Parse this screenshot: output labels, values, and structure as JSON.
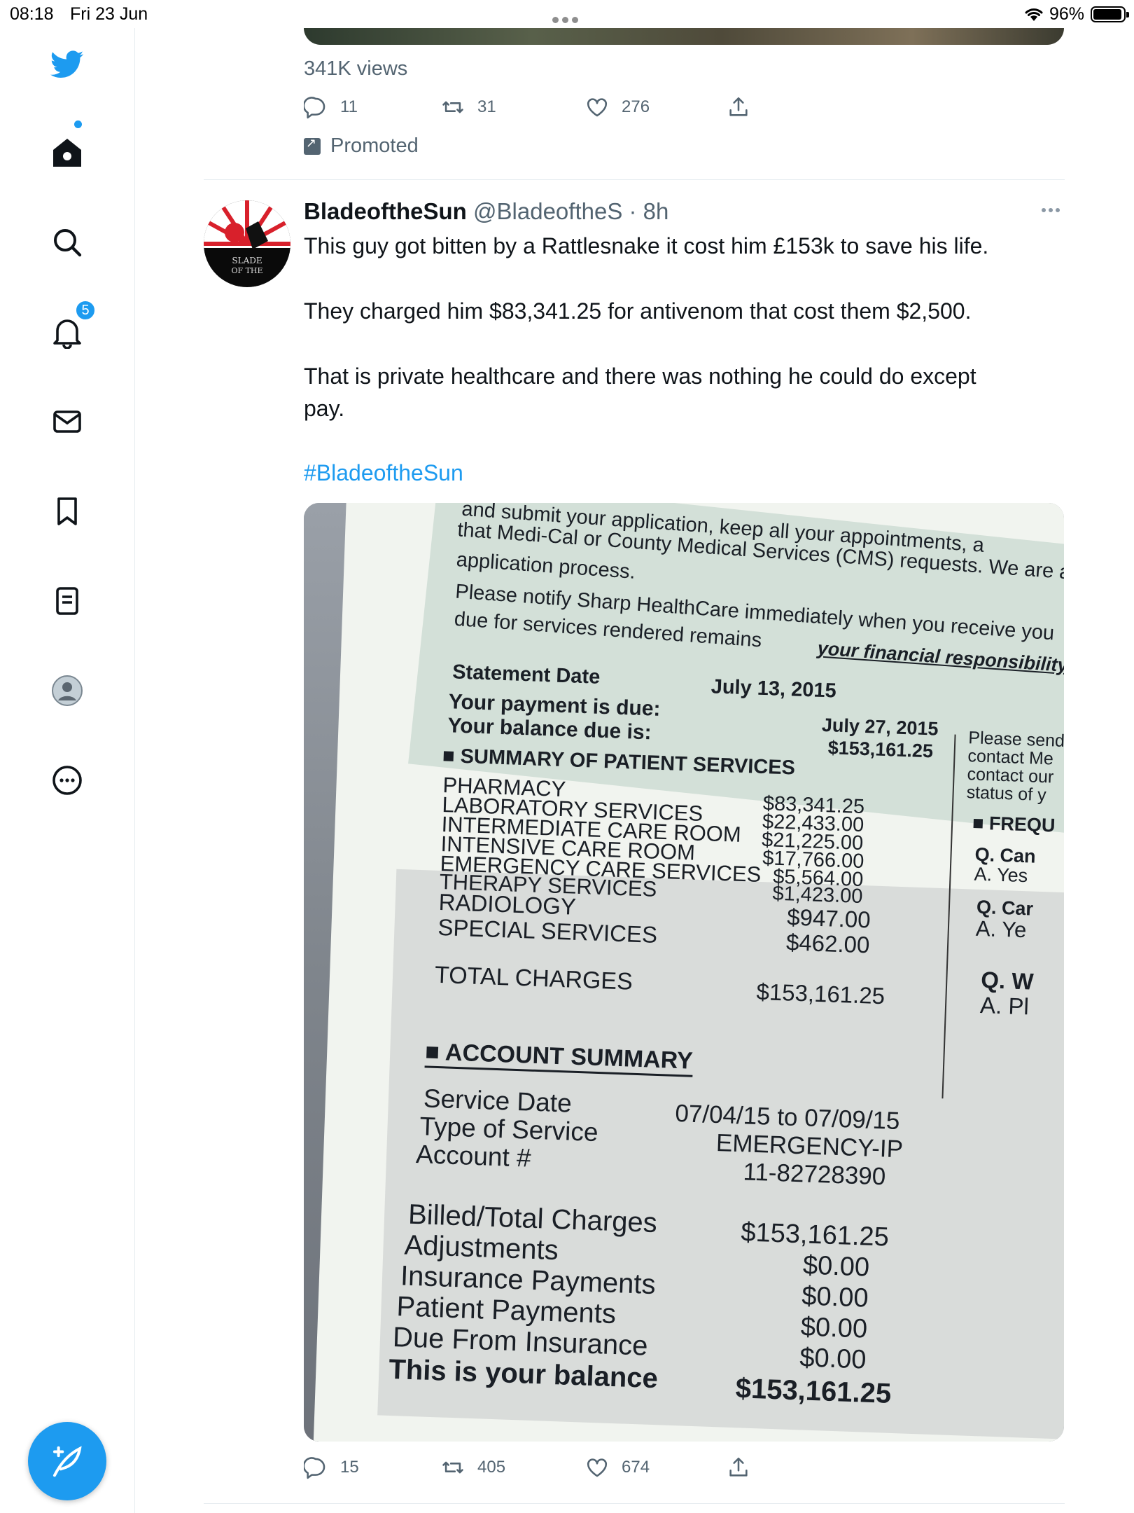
{
  "status_bar": {
    "time": "08:18",
    "date": "Fri 23 Jun",
    "battery": "96%"
  },
  "sidebar": {
    "notifications_badge": "5",
    "items": [
      "twitter-logo",
      "home",
      "search",
      "notifications",
      "messages",
      "bookmarks",
      "lists",
      "profile",
      "more"
    ]
  },
  "prev_tweet": {
    "views": "341K views",
    "replies": "11",
    "retweets": "31",
    "likes": "276",
    "promoted": "Promoted"
  },
  "tweet": {
    "name": "BladeoftheSun",
    "handle": "@BladeoftheS",
    "time": "· 8h",
    "line1": "This guy got bitten by a Rattlesnake it cost him £153k to save his life.",
    "line2": "They charged him $83,341.25 for antivenom that cost them $2,500.",
    "line3a": "That is private healthcare and there was nothing he could do except",
    "line3b": "pay.",
    "hashtag": "#BladeoftheSun",
    "replies": "15",
    "retweets": "405",
    "likes": "674"
  },
  "bill": {
    "top_lines": [
      "and submit your application, keep all your appointments, a",
      "that Medi-Cal or County Medical Services (CMS) requests. We are a",
      "application process."
    ],
    "notify_1": "Please notify Sharp HealthCare immediately when you receive you",
    "notify_2": "due for services rendered remains",
    "notify_3": "your financial responsibility.",
    "statement_date_label": "Statement Date",
    "statement_date": "July 13, 2015",
    "payment_due_label": "Your payment is due:",
    "payment_due": "July 27, 2015",
    "balance_due_label": "Your balance due is:",
    "balance_due": "$153,161.25",
    "summary_title": "SUMMARY OF PATIENT SERVICES",
    "services": [
      {
        "name": "PHARMACY",
        "amount": "$83,341.25"
      },
      {
        "name": "LABORATORY SERVICES",
        "amount": "$22,433.00"
      },
      {
        "name": "INTERMEDIATE CARE ROOM",
        "amount": "$21,225.00"
      },
      {
        "name": "INTENSIVE CARE ROOM",
        "amount": "$17,766.00"
      },
      {
        "name": "EMERGENCY CARE SERVICES",
        "amount": "$5,564.00"
      },
      {
        "name": "THERAPY SERVICES",
        "amount": "$1,423.00"
      },
      {
        "name": "RADIOLOGY",
        "amount": "$947.00"
      },
      {
        "name": "SPECIAL SERVICES",
        "amount": "$462.00"
      }
    ],
    "total_label": "TOTAL CHARGES",
    "total": "$153,161.25",
    "account_title": "ACCOUNT SUMMARY",
    "service_date_label": "Service Date",
    "service_date": "07/04/15 to 07/09/15",
    "service_type_label": "Type of Service",
    "service_type": "EMERGENCY-IP",
    "account_label": "Account #",
    "account": "11-82728390",
    "billed_label": "Billed/Total Charges",
    "billed": "$153,161.25",
    "adjustments_label": "Adjustments",
    "adjustments": "$0.00",
    "insurance_label": "Insurance Payments",
    "insurance": "$0.00",
    "patient_label": "Patient Payments",
    "patient": "$0.00",
    "due_insurance_label": "Due From Insurance",
    "due_insurance": "$0.00",
    "your_balance_label": "This is your balance",
    "your_balance": "$153,161.25",
    "side_text": [
      "Please send",
      "contact Me",
      "contact our",
      "status of y"
    ],
    "side_freq": "FREQU",
    "side_q1": "Q. Can",
    "side_a1": "A. Yes",
    "side_q2": "Q. Car",
    "side_a2": "A. Ye",
    "side_q3": "Q. W",
    "side_a3": "A. Pl"
  }
}
